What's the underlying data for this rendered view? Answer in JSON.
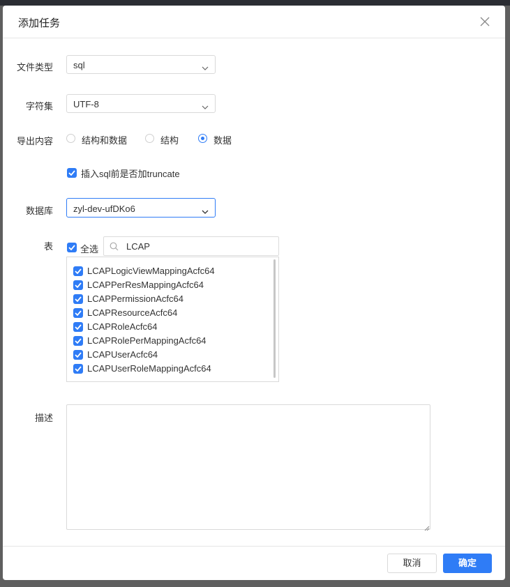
{
  "dialog": {
    "title": "添加任务",
    "close_icon": "close-icon"
  },
  "form": {
    "file_type": {
      "label": "文件类型",
      "value": "sql"
    },
    "charset": {
      "label": "字符集",
      "value": "UTF-8"
    },
    "export_content": {
      "label": "导出内容",
      "options": [
        "结构和数据",
        "结构",
        "数据"
      ],
      "selected": "数据"
    },
    "truncate": {
      "label": "插入sql前是否加truncate",
      "checked": true
    },
    "database": {
      "label": "数据库",
      "value": "zyl-dev-ufDKo6"
    },
    "tables": {
      "label": "表",
      "select_all_label": "全选",
      "select_all_checked": true,
      "search_value": "LCAP",
      "search_icon": "search-icon",
      "items": [
        "LCAPLogicViewMappingAcfc64",
        "LCAPPerResMappingAcfc64",
        "LCAPPermissionAcfc64",
        "LCAPResourceAcfc64",
        "LCAPRoleAcfc64",
        "LCAPRolePerMappingAcfc64",
        "LCAPUserAcfc64",
        "LCAPUserRoleMappingAcfc64"
      ]
    },
    "description": {
      "label": "描述",
      "value": ""
    }
  },
  "footer": {
    "cancel_label": "取消",
    "ok_label": "确定"
  },
  "colors": {
    "accent": "#2f7cf6",
    "border": "#d9d9d9",
    "overlay": "#5f5f5f"
  }
}
